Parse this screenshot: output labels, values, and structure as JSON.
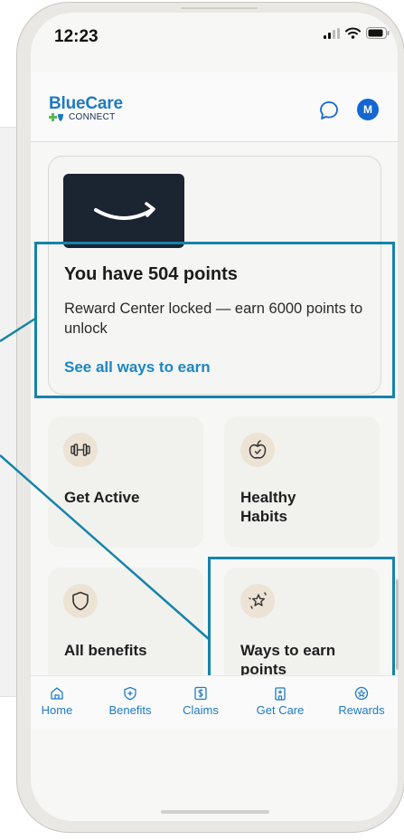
{
  "status_bar": {
    "time": "12:23"
  },
  "header": {
    "logo_main": "BlueCare",
    "logo_sub": "CONNECT",
    "avatar_initial": "M"
  },
  "reward_card": {
    "brand": "amazon",
    "title": "You have 504 points",
    "description": "Reward Center locked — earn 6000 points to unlock",
    "link": "See all ways to earn"
  },
  "tiles": [
    {
      "label": "Get Active",
      "icon": "dumbbell-icon"
    },
    {
      "label": "Healthy Habits",
      "icon": "apple-icon"
    },
    {
      "label": "All benefits",
      "icon": "shield-icon"
    },
    {
      "label": "Ways to earn points",
      "icon": "stars-icon"
    }
  ],
  "tabbar": {
    "items": [
      {
        "label": "Home",
        "icon": "home-icon"
      },
      {
        "label": "Benefits",
        "icon": "benefits-icon"
      },
      {
        "label": "Claims",
        "icon": "claims-icon"
      },
      {
        "label": "Get Care",
        "icon": "get-care-icon"
      },
      {
        "label": "Rewards",
        "icon": "rewards-icon"
      }
    ]
  },
  "colors": {
    "accent_blue": "#1e7bc0",
    "highlight_teal": "#1584a9",
    "avatar_blue": "#1467d3",
    "icon_circle": "#ece3d4"
  }
}
